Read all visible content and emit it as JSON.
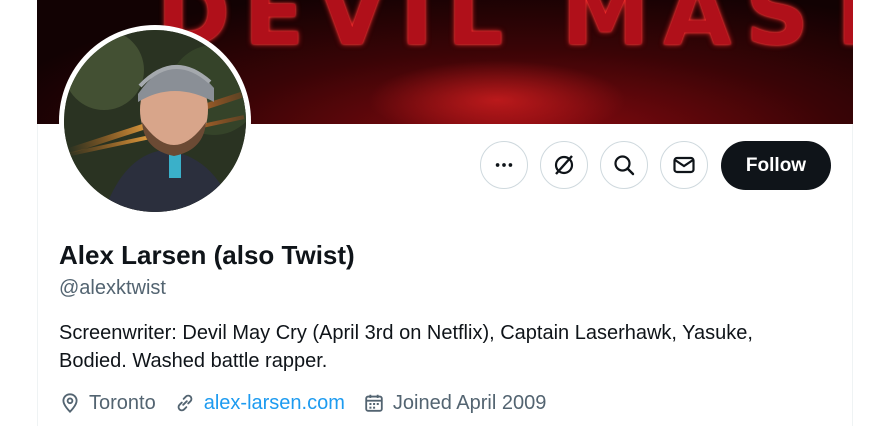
{
  "banner": {
    "text": "DEVIL MASTERS"
  },
  "actions": {
    "more_icon": "more-horizontal-icon",
    "grok_icon": "grok-icon",
    "search_icon": "search-icon",
    "message_icon": "mail-icon",
    "follow_label": "Follow"
  },
  "profile": {
    "name": "Alex Larsen (also Twist)",
    "handle": "@alexktwist",
    "bio": "Screenwriter: Devil May Cry (April 3rd on Netflix), Captain Laserhawk, Yasuke, Bodied. Washed battle rapper.",
    "location": "Toronto",
    "website": "alex-larsen.com",
    "joined": "Joined April 2009"
  },
  "colors": {
    "primary_text": "#0f1419",
    "secondary_text": "#536471",
    "link": "#1d9bf0",
    "follow_bg": "#0f1419"
  }
}
